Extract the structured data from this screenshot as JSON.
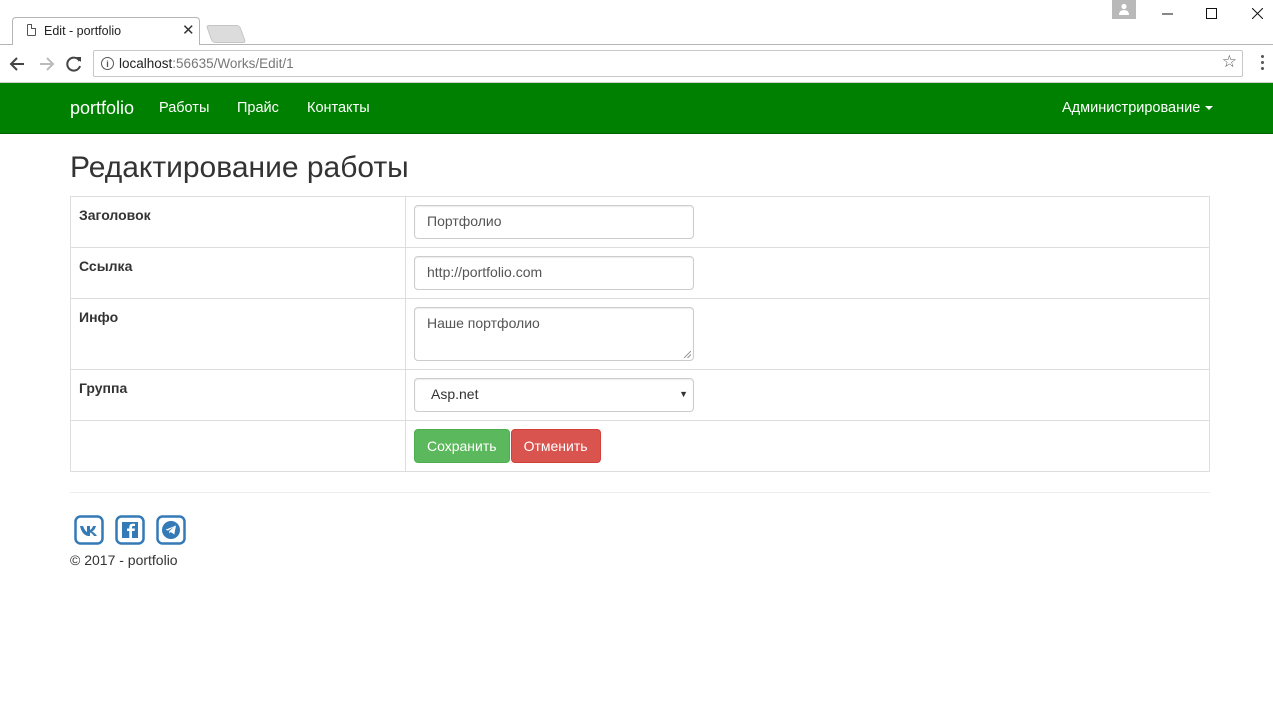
{
  "browser": {
    "tab_title": "Edit - portfolio",
    "url_host": "localhost",
    "url_rest": ":56635/Works/Edit/1",
    "icons": [
      "back-icon",
      "forward-icon",
      "reload-icon",
      "info-icon",
      "star-icon",
      "menu-icon",
      "profile-icon"
    ]
  },
  "navbar": {
    "brand": "portfolio",
    "links": [
      "Работы",
      "Прайс",
      "Контакты"
    ],
    "admin": "Администрирование",
    "color": "#008000"
  },
  "page": {
    "title": "Редактирование работы"
  },
  "form": {
    "title_label": "Заголовок",
    "title_value": "Портфолио",
    "link_label": "Ссылка",
    "link_value": "http://portfolio.com",
    "info_label": "Инфо",
    "info_value": "Наше портфолио",
    "group_label": "Группа",
    "group_value": "Asp.net",
    "save_label": "Сохранить",
    "cancel_label": "Отменить",
    "save_color": "#5cb85c",
    "cancel_color": "#d9534f"
  },
  "footer": {
    "social_icons": [
      "vk-icon",
      "facebook-icon",
      "telegram-icon"
    ],
    "copyright": "© 2017 - portfolio"
  }
}
